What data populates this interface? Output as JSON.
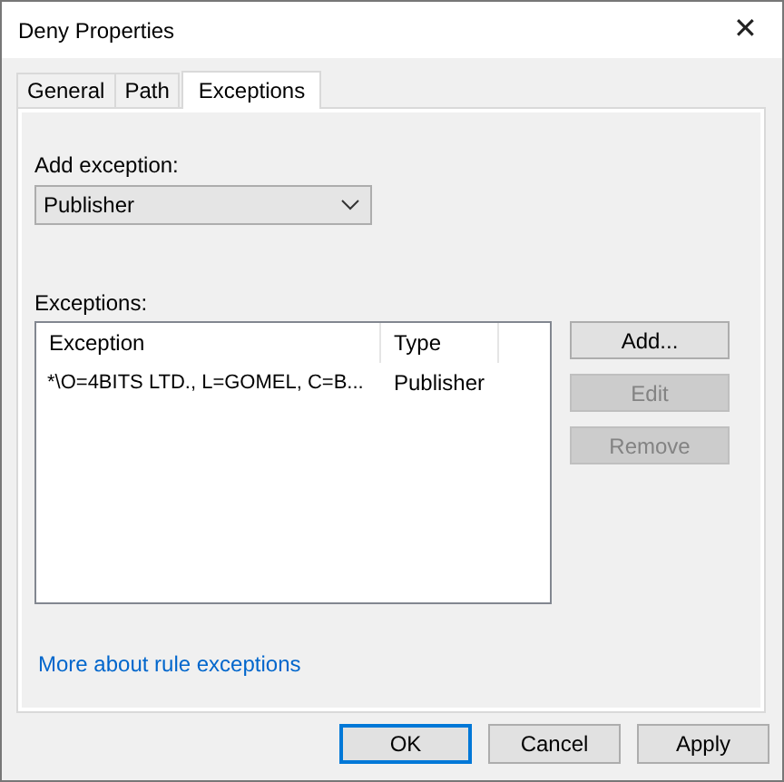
{
  "window": {
    "title": "Deny Properties",
    "close": "✕"
  },
  "tabs": [
    {
      "label": "General",
      "selected": false
    },
    {
      "label": "Path",
      "selected": false
    },
    {
      "label": "Exceptions",
      "selected": true
    }
  ],
  "add_exception": {
    "label": "Add exception:",
    "value": "Publisher"
  },
  "exceptions": {
    "label": "Exceptions:",
    "columns": [
      "Exception",
      "Type"
    ],
    "rows": [
      {
        "cells": [
          "*\\O=4BITS LTD., L=GOMEL, C=B...",
          "Publisher"
        ],
        "selected": false
      }
    ],
    "buttons": [
      {
        "label": "Add...",
        "disabled": false
      },
      {
        "label": "Edit",
        "disabled": true
      },
      {
        "label": "Remove",
        "disabled": true
      }
    ]
  },
  "link": "More about rule exceptions",
  "buttons": [
    {
      "label": "OK",
      "default": true
    },
    {
      "label": "Cancel",
      "default": false
    },
    {
      "label": "Apply",
      "default": false
    }
  ]
}
